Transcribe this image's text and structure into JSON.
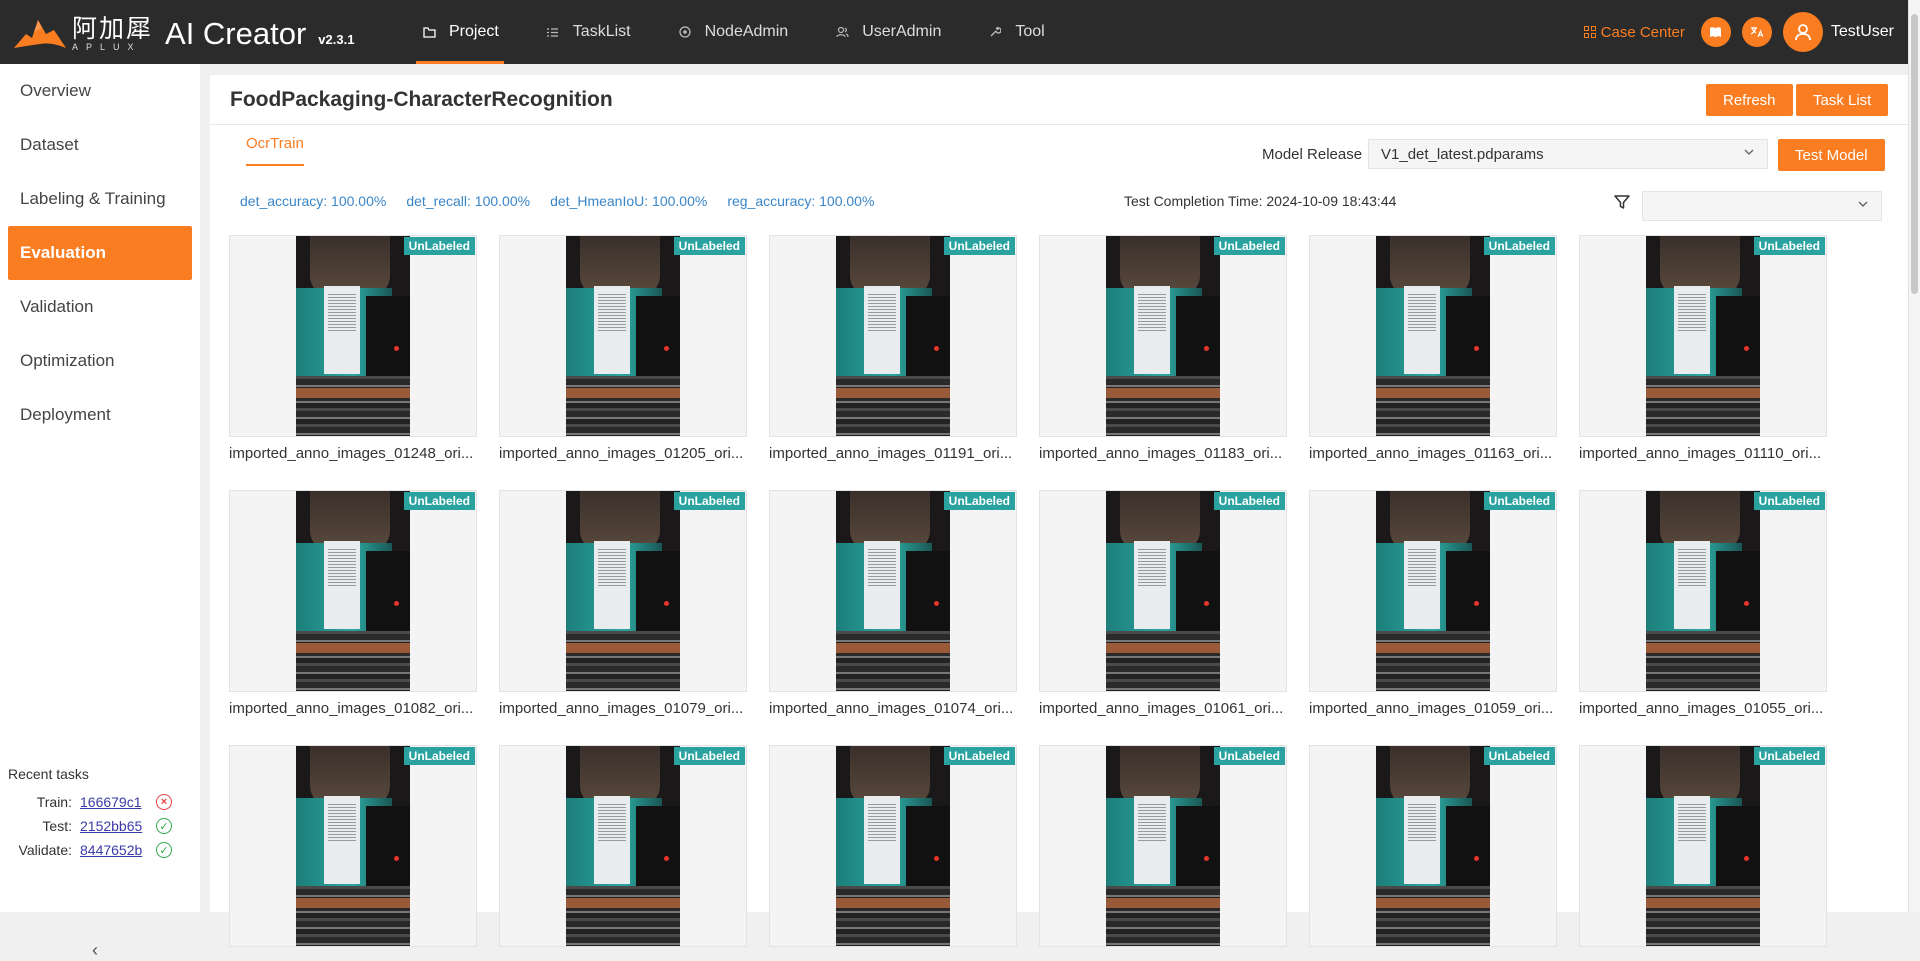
{
  "brand": {
    "cn": "阿加犀",
    "en": "APLUX",
    "app_name": "AI Creator",
    "version": "v2.3.1",
    "accent": "#fa7d22"
  },
  "nav": [
    {
      "label": "Project",
      "icon": "folder-icon",
      "active": true
    },
    {
      "label": "TaskList",
      "icon": "list-icon"
    },
    {
      "label": "NodeAdmin",
      "icon": "node-icon"
    },
    {
      "label": "UserAdmin",
      "icon": "users-icon"
    },
    {
      "label": "Tool",
      "icon": "wrench-icon"
    }
  ],
  "topright": {
    "case_center": "Case Center",
    "username": "TestUser"
  },
  "sidebar": {
    "items": [
      {
        "label": "Overview"
      },
      {
        "label": "Dataset"
      },
      {
        "label": "Labeling & Training"
      },
      {
        "label": "Evaluation",
        "active": true
      },
      {
        "label": "Validation"
      },
      {
        "label": "Optimization"
      },
      {
        "label": "Deployment"
      }
    ],
    "recent": {
      "title": "Recent tasks",
      "rows": [
        {
          "label": "Train:",
          "id": "166679c1",
          "status": "failed"
        },
        {
          "label": "Test:",
          "id": "2152bb65",
          "status": "success"
        },
        {
          "label": "Validate:",
          "id": "8447652b",
          "status": "success"
        }
      ]
    }
  },
  "main": {
    "title": "FoodPackaging-CharacterRecognition",
    "refresh_label": "Refresh",
    "tasklist_label": "Task List",
    "tab": "OcrTrain",
    "model_release_label": "Model Release",
    "model_release_value": "V1_det_latest.pdparams",
    "test_model_label": "Test Model",
    "metrics": [
      "det_accuracy:  100.00%",
      "det_recall:  100.00%",
      "det_HmeanIoU:  100.00%",
      "reg_accuracy:  100.00%"
    ],
    "completion": "Test Completion Time: 2024-10-09 18:43:44",
    "badge": "UnLabeled",
    "images": [
      "imported_anno_images_01248_ori...",
      "imported_anno_images_01205_ori...",
      "imported_anno_images_01191_ori...",
      "imported_anno_images_01183_ori...",
      "imported_anno_images_01163_ori...",
      "imported_anno_images_01110_ori...",
      "imported_anno_images_01082_ori...",
      "imported_anno_images_01079_ori...",
      "imported_anno_images_01074_ori...",
      "imported_anno_images_01061_ori...",
      "imported_anno_images_01059_ori...",
      "imported_anno_images_01055_ori...",
      "",
      "",
      "",
      "",
      "",
      ""
    ]
  }
}
